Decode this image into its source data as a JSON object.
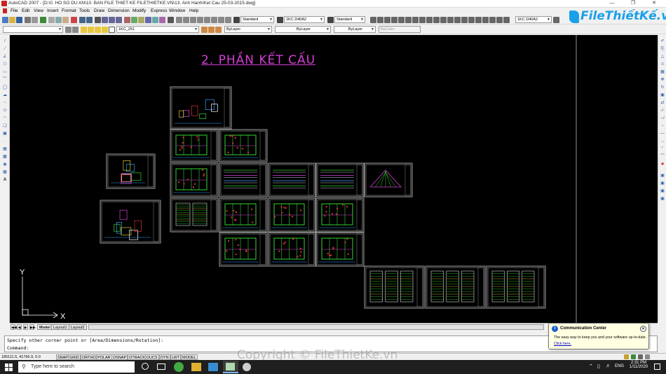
{
  "window": {
    "title": "AutoCAD 2007 - [D:\\0. HO SO DU AN\\10. BAN FILE THIET KE FILETHIETKE.VN\\13. Anh Hanh\\Ket Cau 25-03-2015.dwg]"
  },
  "menu": [
    "File",
    "Edit",
    "View",
    "Insert",
    "Format",
    "Tools",
    "Draw",
    "Dimension",
    "Modify",
    "Express",
    "Window",
    "Help"
  ],
  "toolbar": {
    "text_style": "Standard",
    "dim_style": "1KC D40A2",
    "table_style": "Standard",
    "mleader_style": "1KC D40A2",
    "layer": "1KC_251",
    "color": "ByLayer",
    "linetype": "ByLayer",
    "lineweight": "ByLayer",
    "plotstyle": "ByColor"
  },
  "logo": {
    "text": "FileThiếtKế.vn"
  },
  "drawing": {
    "title": "2. PHẦN KẾT CẤU",
    "ucs_x": "X",
    "ucs_y": "Y"
  },
  "tabs": [
    "Model",
    "Layout1",
    "Layout2"
  ],
  "command": {
    "history": "Specify other corner point or [Area/Dimensions/Rotation]:",
    "prompt": "Command:"
  },
  "status": {
    "coords": "185111.5, 41766.9, 0.0",
    "toggles": [
      "SNAP",
      "GRID",
      "ORTHO",
      "POLAR",
      "OSNAP",
      "OTRACK",
      "DUCS",
      "DYN",
      "LWT",
      "MODEL"
    ]
  },
  "popup": {
    "title": "Communication Center",
    "description": "The easy way to keep you and your software up-to-date.",
    "link": "Click here."
  },
  "taskbar": {
    "search_placeholder": "Type here to search",
    "language": "ENG",
    "time": "2:31 PM",
    "date": "1/11/2020"
  },
  "watermark": "Copyright © FileThietKe.vn",
  "colors": {
    "canvas": "#000000",
    "title_magenta": "#d63fd6",
    "sheet_border": "#c8c8c8",
    "accent_blue": "#1aa0e8"
  }
}
